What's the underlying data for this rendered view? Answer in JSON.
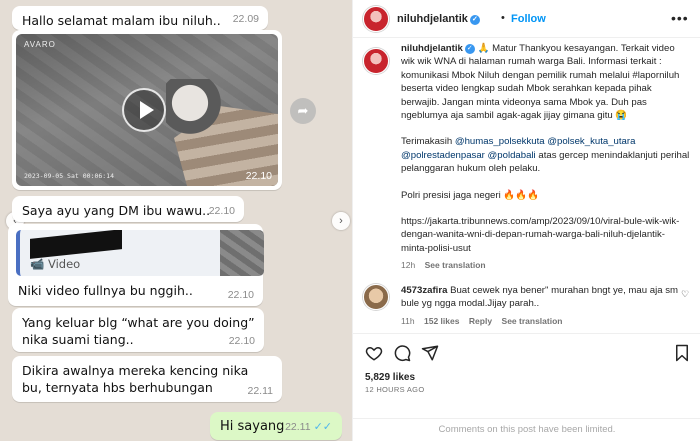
{
  "chat": {
    "messages": [
      {
        "text": "Hallo selamat malam ibu niluh..",
        "time": "22.09"
      },
      {
        "text": "",
        "time": "22.10",
        "video_brand": "AVARO",
        "video_timestamp": "2023-09-05 Sat 00:06:14"
      },
      {
        "text": "Saya ayu yang DM ibu wawu..",
        "time": "22.10"
      },
      {
        "quoted_label": "Video",
        "text": "Niki video fullnya bu nggih..",
        "time": "22.10"
      },
      {
        "text": "Yang keluar blg “what are you doing” nika suami tiang..",
        "time": "22.10"
      },
      {
        "text": "Dikira awalnya mereka kencing nika bu, ternyata hbs berhubungan",
        "time": "22.11"
      },
      {
        "text": "Hi sayang",
        "time": "22.11",
        "outgoing": true
      }
    ]
  },
  "post": {
    "username": "niluhdjelantik",
    "follow_label": "Follow",
    "more_label": "•••",
    "caption": {
      "p1": "🙏 Matur Thankyou kesayangan. Terkait video wik wik WNA di halaman rumah warga Bali. Informasi terkait : komunikasi Mbok Niluh dengan pemilik rumah melalui #laporniluh beserta video lengkap sudah Mbok serahkan kepada pihak berwajib. Jangan minta videonya sama Mbok ya. Duh pas ngeblumya aja sambil agak-agak jijay gimana gitu 😭",
      "p2_prefix": "Terimakasih ",
      "p2_mentions": "@humas_polsekkuta @polsek_kuta_utara @polrestadenpasar @poldabali",
      "p2_suffix": " atas gercep menindaklanjuti perihal pelanggaran hukum oleh pelaku.",
      "p3": "Polri presisi jaga negeri 🔥🔥🔥",
      "p4": "https://jakarta.tribunnews.com/amp/2023/09/10/viral-bule-wik-wik-dengan-wanita-wni-di-depan-rumah-warga-bali-niluh-djelantik-minta-polisi-usut",
      "age": "12h",
      "see_translation": "See translation"
    },
    "comment": {
      "username": "4573zafira",
      "text": " Buat cewek nya bener\" murahan bngt ye, mau aja sm bule yg ngga modal.Jijay parah..",
      "age": "11h",
      "likes": "152 likes",
      "reply": "Reply",
      "see_translation": "See translation"
    },
    "likes_count": "5,829 likes",
    "posted_ago": "12 HOURS AGO",
    "comments_limited": "Comments on this post have been limited."
  }
}
